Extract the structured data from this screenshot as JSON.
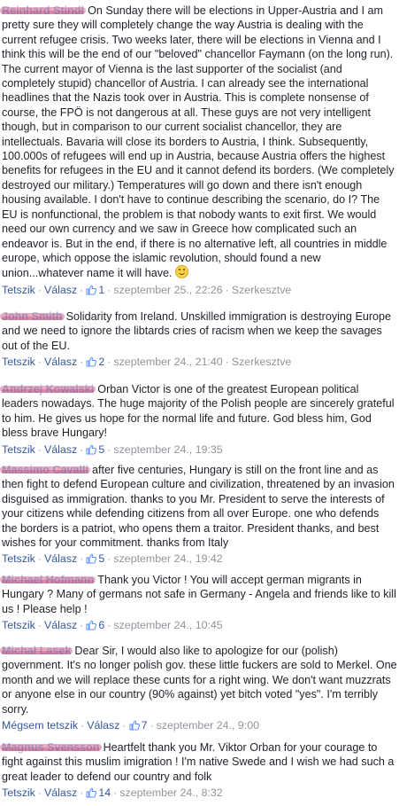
{
  "comments": [
    {
      "author": "Reinhard Stindl",
      "text": "On Sunday there will be elections in Upper-Austria and I am pretty sure they will completely change the way Austria is dealing with the current refugee crisis. Two weeks later, there will be elections in Vienna and I think this will be the end of our \"beloved\" chancellor Faymann (on the long run). The current mayor of Vienna is the last supporter of the socialist (and completely stupid) chancellor of Austria. I can already see the international headlines that the Nazis took over in Austria. This is complete nonsense of course, the FPÖ is not dangerous at all. These guys are not very intelligent though, but in comparison to our current socialist chancellor, they are intellectuals. Bavaria will close its borders to Austria, I think. Subsequently, 100.000s of refugees will end up in Austria, because Austria offers the highest benefits for refugees in the EU and it cannot defend its borders. (We completely destroyed our military.) Temperatures will go down and there isn't enough housing available. I don't have to continue describing the scenario, do I? The EU is nonfunctional, the problem is that nobody wants to exit first. We would need our own currency and we saw in Greece how complicated such an endeavor is. But in the end, if there is no alternative left, all countries in middle europe, which oppose the islamic revolution, should found a new union...whatever name it will have.",
      "emoji": "smile-emoji",
      "like_label": "Tetszik",
      "reply_label": "Válasz",
      "likes": "1",
      "time": "szeptember 25., 22:26",
      "edited": "Szerkesztve"
    },
    {
      "author": "John Smith",
      "text": "Solidarity from Ireland. Unskilled immigration is destroying Europe and we need to ignore the libtards cries of racism when we keep the savages out of the EU.",
      "like_label": "Tetszik",
      "reply_label": "Válasz",
      "likes": "2",
      "time": "szeptember 24., 21:40",
      "edited": "Szerkesztve"
    },
    {
      "author": "Andrzej Kowalski",
      "text": "Orban Victor is one of the greatest European political leaders nowadays. The huge majority of the Polish people are sincerely grateful to him. He gives us hope for the normal life and future. God bless him, God bless brave Hungary!",
      "like_label": "Tetszik",
      "reply_label": "Válasz",
      "likes": "5",
      "time": "szeptember 24., 19:35"
    },
    {
      "author": "Massimo Cavalli",
      "text": "after five centuries, Hungary is still on the front line and as then fight to defend European culture and civilization, threatened by an invasion disguised as immigration. thanks to you Mr. President to serve the interests of your citizens while defending citizens from all over Europe. one who defends the borders is a patriot, who opens them a traitor. President thanks, and best wishes for your commitment. thanks from Italy",
      "like_label": "Tetszik",
      "reply_label": "Válasz",
      "likes": "5",
      "time": "szeptember 24., 19:42"
    },
    {
      "author": "Michael Hofmann",
      "text": "Thank you Victor ! You will accept german migrants in Hungary ? Many of germans not safe in Germany - Angela and friends like to kill us ! Please help !",
      "like_label": "Tetszik",
      "reply_label": "Válasz",
      "likes": "6",
      "time": "szeptember 24., 10:45"
    },
    {
      "author": "Michał Lasek",
      "text": "Dear Sir, I would also like to apologize for our (polish) government. It's no longer polish gov. these little fuckers are sold to Merkel. One month and we will replace these cunts for a right wing. We don't want muzzrats or anyone else in our country (90% against) yet bitch voted \"yes\". I'm terribly sorry.",
      "like_label": "Mégsem tetszik",
      "reply_label": "Válasz",
      "likes": "7",
      "time": "szeptember 24., 9:00"
    },
    {
      "author": "Magnus Svensson",
      "text": "Heartfelt thank you Mr. Viktor Orban for your courage to fight against this muslim imigration ! I'm native Swede and I wish we had such a great leader to defend our country and folk",
      "like_label": "Tetszik",
      "reply_label": "Válasz",
      "likes": "14",
      "time": "szeptember 24., 8:32"
    }
  ]
}
